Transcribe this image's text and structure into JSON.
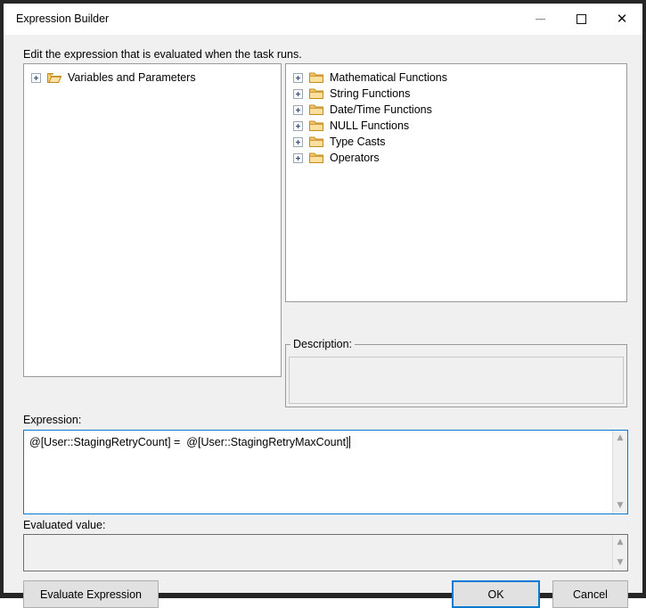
{
  "window": {
    "title": "Expression Builder",
    "caption_buttons": [
      {
        "name": "minimize-button",
        "label": "—"
      },
      {
        "name": "maximize-button",
        "label": "□"
      },
      {
        "name": "close-button",
        "label": "✕"
      }
    ]
  },
  "instruction": "Edit the expression that is evaluated when the task runs.",
  "left_tree": {
    "items": [
      {
        "label": "Variables and Parameters",
        "expander": "+",
        "icon": "open-folder-icon"
      }
    ]
  },
  "right_tree": {
    "items": [
      {
        "label": "Mathematical Functions",
        "expander": "+",
        "icon": "folder-icon"
      },
      {
        "label": "String Functions",
        "expander": "+",
        "icon": "folder-icon"
      },
      {
        "label": "Date/Time Functions",
        "expander": "+",
        "icon": "folder-icon"
      },
      {
        "label": "NULL Functions",
        "expander": "+",
        "icon": "folder-icon"
      },
      {
        "label": "Type Casts",
        "expander": "+",
        "icon": "folder-icon"
      },
      {
        "label": "Operators",
        "expander": "+",
        "icon": "folder-icon"
      }
    ]
  },
  "description": {
    "legend": "Description:",
    "text": ""
  },
  "expression": {
    "label": "Expression:",
    "value": "@[User::StagingRetryCount] =  @[User::StagingRetryMaxCount]",
    "placeholder": ""
  },
  "evaluated_value": {
    "label": "Evaluated value:",
    "value": ""
  },
  "buttons": {
    "evaluate": "Evaluate Expression",
    "ok": "OK",
    "cancel": "Cancel"
  },
  "scrollbars": {
    "up_arrow": "▲",
    "down_arrow": "▼"
  },
  "colors": {
    "accent": "#0a7ad1",
    "window_background": "#f0f0f0",
    "panel_background": "#ffffff",
    "frame": "#262626",
    "folder": "#e8b44b"
  }
}
